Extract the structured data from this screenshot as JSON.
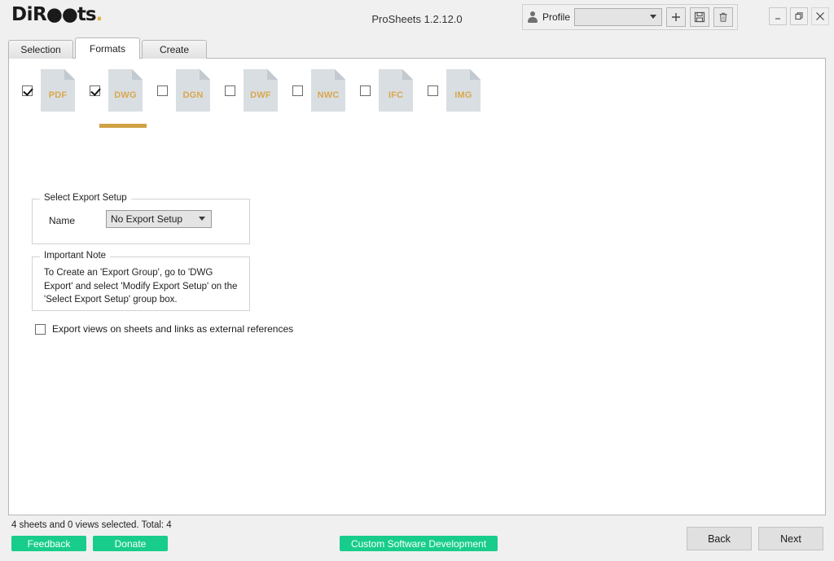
{
  "window": {
    "logo_text": "DiRoots",
    "app_title": "ProSheets 1.2.12.0",
    "minimize_label": "_",
    "restore_label": "Restore",
    "close_label": "X"
  },
  "profile": {
    "icon": "person-icon",
    "label": "Profile",
    "value": "",
    "placeholder": "",
    "add_icon": "plus-icon",
    "save_icon": "floppy-disk-icon",
    "delete_icon": "trash-icon"
  },
  "tabs": [
    {
      "label": "Selection",
      "active": false
    },
    {
      "label": "Formats",
      "active": true
    },
    {
      "label": "Create",
      "active": false
    }
  ],
  "formats": [
    {
      "label": "PDF",
      "checked": true,
      "active": false
    },
    {
      "label": "DWG",
      "checked": true,
      "active": true
    },
    {
      "label": "DGN",
      "checked": false,
      "active": false
    },
    {
      "label": "DWF",
      "checked": false,
      "active": false
    },
    {
      "label": "NWC",
      "checked": false,
      "active": false
    },
    {
      "label": "IFC",
      "checked": false,
      "active": false
    },
    {
      "label": "IMG",
      "checked": false,
      "active": false
    }
  ],
  "export_setup": {
    "group_title": "Select Export Setup",
    "name_label": "Name",
    "name_value": "No Export Setup"
  },
  "important_note": {
    "group_title": "Important Note",
    "text": "To Create an 'Export Group', go to 'DWG Export' and select 'Modify Export Setup' on the 'Select Export Setup' group box."
  },
  "options": {
    "export_views_label": "Export views on sheets and links as external references",
    "export_views_checked": false
  },
  "footer": {
    "status": "4 sheets and 0 views selected. Total: 4",
    "feedback_label": "Feedback",
    "donate_label": "Donate",
    "custom_software_label": "Custom Software Development",
    "back_label": "Back",
    "next_label": "Next"
  },
  "colors": {
    "green": "#18cd8c",
    "orange": "#d0a246",
    "file_icon": "#d9dee2"
  }
}
